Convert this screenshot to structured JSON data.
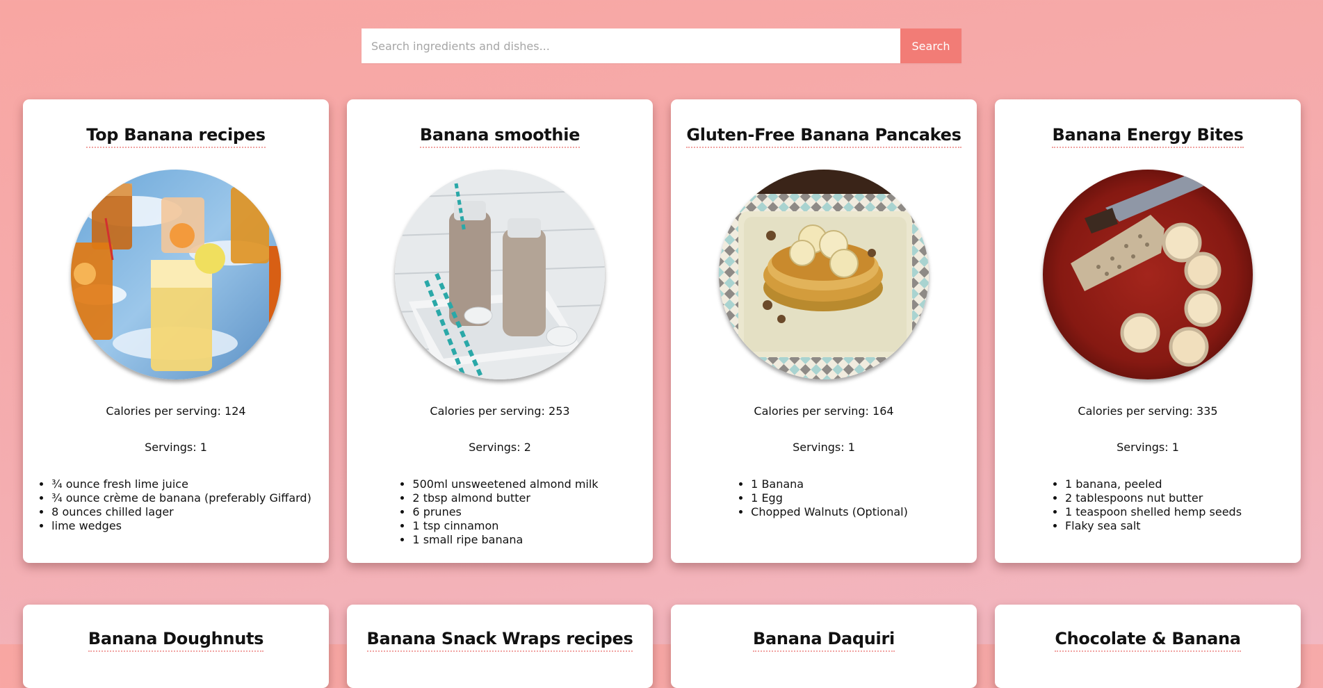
{
  "search": {
    "placeholder": "Search ingredients and dishes...",
    "button_label": "Search"
  },
  "recipes": [
    {
      "title": "Top Banana recipes",
      "image_icon": "iced-drinks-photo",
      "calories": "Calories per serving: 124",
      "servings": "Servings: 1",
      "ingredients": [
        "¾ ounce fresh lime juice",
        "¾ ounce crème de banana (preferably Giffard)",
        "8 ounces chilled lager",
        "lime wedges"
      ]
    },
    {
      "title": "Banana smoothie",
      "image_icon": "smoothie-bottles-photo",
      "calories": "Calories per serving: 253",
      "servings": "Servings: 2",
      "ingredients": [
        "500ml unsweetened almond milk",
        "2 tbsp almond butter",
        "6 prunes",
        "1 tsp cinnamon",
        "1 small ripe banana"
      ]
    },
    {
      "title": "Gluten-Free Banana Pancakes",
      "image_icon": "pancakes-plate-photo",
      "calories": "Calories per serving: 164",
      "servings": "Servings: 1",
      "ingredients": [
        "1 Banana",
        "1 Egg",
        "Chopped Walnuts (Optional)"
      ]
    },
    {
      "title": "Banana Energy Bites",
      "image_icon": "energy-bites-photo",
      "calories": "Calories per serving: 335",
      "servings": "Servings: 1",
      "ingredients": [
        "1 banana, peeled",
        "2 tablespoons nut butter",
        "1 teaspoon shelled hemp seeds",
        "Flaky sea salt"
      ]
    }
  ],
  "recipes_row2": [
    {
      "title": "Banana Doughnuts"
    },
    {
      "title": "Banana Snack Wraps recipes"
    },
    {
      "title": "Banana Daquiri"
    },
    {
      "title": "Chocolate & Banana"
    }
  ],
  "colors": {
    "accent": "#f27c76",
    "background_top": "#f8a6a2",
    "background_bottom": "#f2b8c2",
    "title_underline": "#f1a2a0"
  }
}
